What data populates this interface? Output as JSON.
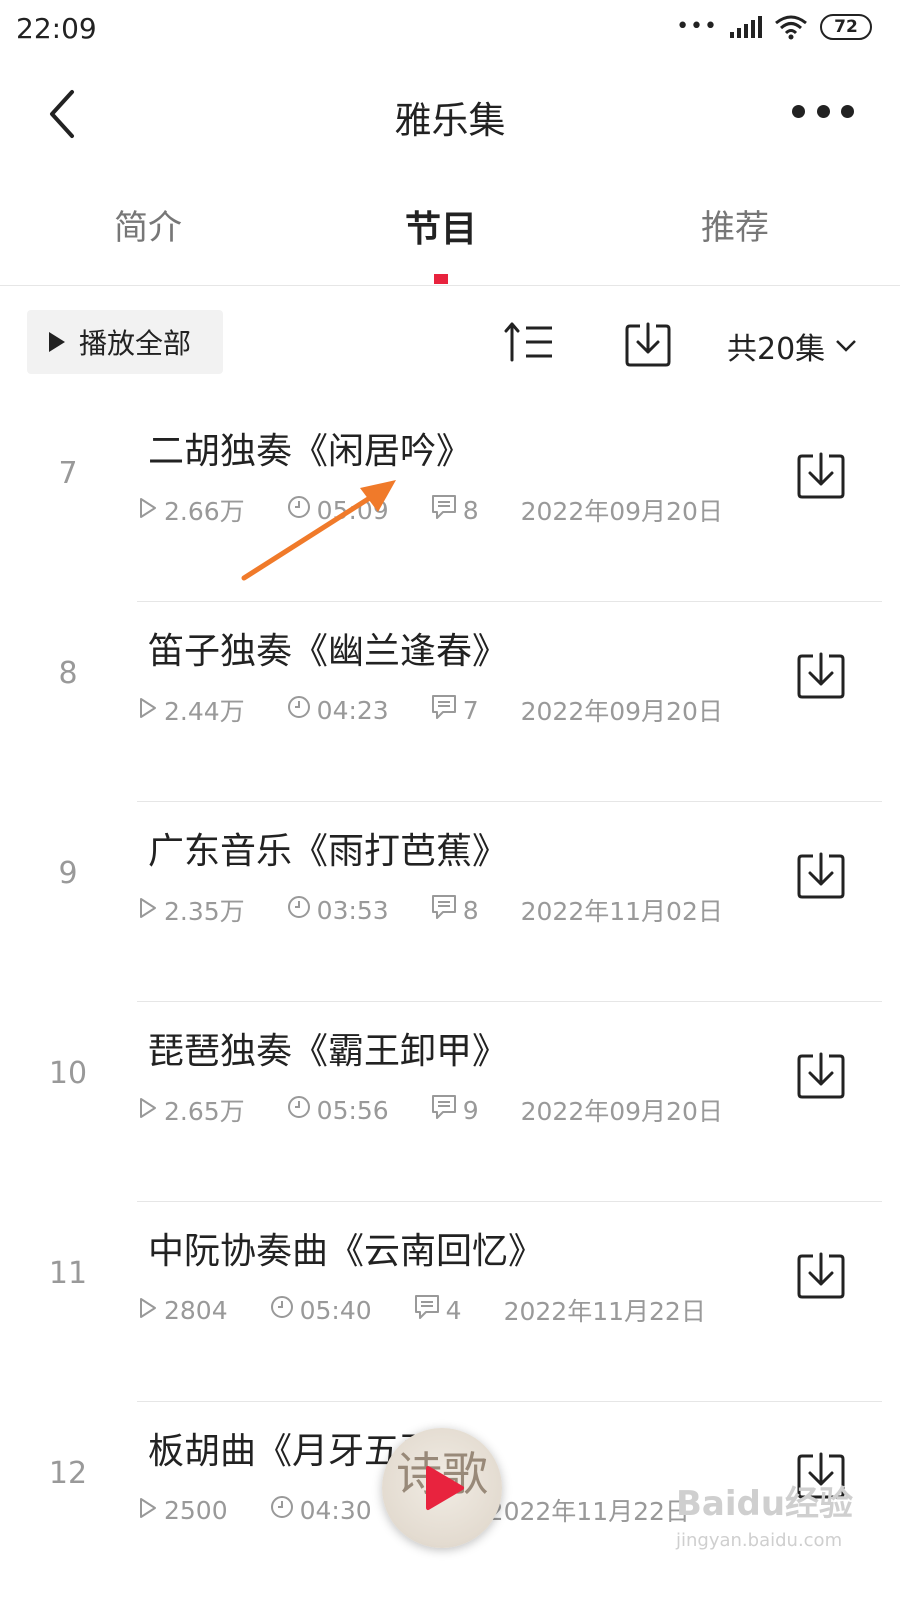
{
  "status_bar": {
    "time": "22:09",
    "battery": "72",
    "dots": "•••"
  },
  "header": {
    "title": "雅乐集"
  },
  "tabs": [
    {
      "label": "简介"
    },
    {
      "label": "节目"
    },
    {
      "label": "推荐"
    }
  ],
  "toolbar": {
    "play_all_label": "播放全部",
    "episodes_label": "共20集"
  },
  "items": [
    {
      "number": "7",
      "title": "二胡独奏《闲居吟》",
      "plays": "2.66万",
      "duration": "05:09",
      "comments": "8",
      "date": "2022年09月20日"
    },
    {
      "number": "8",
      "title": "笛子独奏《幽兰逢春》",
      "plays": "2.44万",
      "duration": "04:23",
      "comments": "7",
      "date": "2022年09月20日"
    },
    {
      "number": "9",
      "title": "广东音乐《雨打芭蕉》",
      "plays": "2.35万",
      "duration": "03:53",
      "comments": "8",
      "date": "2022年11月02日"
    },
    {
      "number": "10",
      "title": "琵琶独奏《霸王卸甲》",
      "plays": "2.65万",
      "duration": "05:56",
      "comments": "9",
      "date": "2022年09月20日"
    },
    {
      "number": "11",
      "title": "中阮协奏曲《云南回忆》",
      "plays": "2804",
      "duration": "05:40",
      "comments": "4",
      "date": "2022年11月22日"
    },
    {
      "number": "12",
      "title": "板胡曲《月牙五更》",
      "plays": "2500",
      "duration": "04:30",
      "comments": "",
      "date": "2022年11月22日"
    }
  ],
  "mini_player": {
    "cover_text": "诗歌"
  },
  "watermark": {
    "text": "Baidu经验",
    "sub": "jingyan.baidu.com"
  },
  "colors": {
    "accent": "#e8233e",
    "arrow": "#f07a2a",
    "muted": "#999999"
  }
}
